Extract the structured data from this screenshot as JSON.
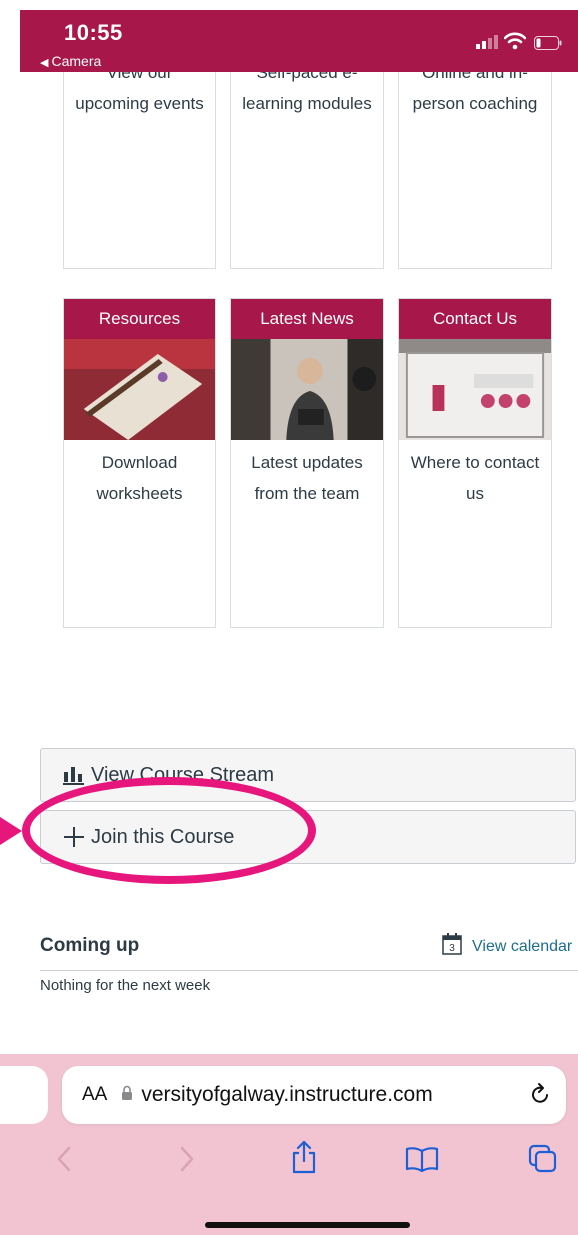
{
  "status_bar": {
    "time": "10:55",
    "back_label": "Camera"
  },
  "tiles_row1": [
    {
      "desc": "View our\nupcoming events"
    },
    {
      "desc": "Self-paced e-\nlearning modules"
    },
    {
      "desc": "Online and in-\nperson coaching"
    }
  ],
  "tiles_row2": [
    {
      "title": "Resources",
      "desc": "Download\nworksheets"
    },
    {
      "title": "Latest News",
      "desc": "Latest updates\nfrom the team"
    },
    {
      "title": "Contact Us",
      "desc": "Where to contact\nus"
    }
  ],
  "actions": {
    "stream_label": "View Course Stream",
    "join_label": "Join this Course"
  },
  "coming_up": {
    "title": "Coming up",
    "view_calendar": "View calendar",
    "calendar_day": "3",
    "empty_text": "Nothing for the next week"
  },
  "browser": {
    "text_size_label": "AA",
    "url": "versityofgalway.instructure.com"
  },
  "colors": {
    "brand": "#a8174a",
    "annotation": "#e6167d",
    "link": "#1d6f8c"
  }
}
